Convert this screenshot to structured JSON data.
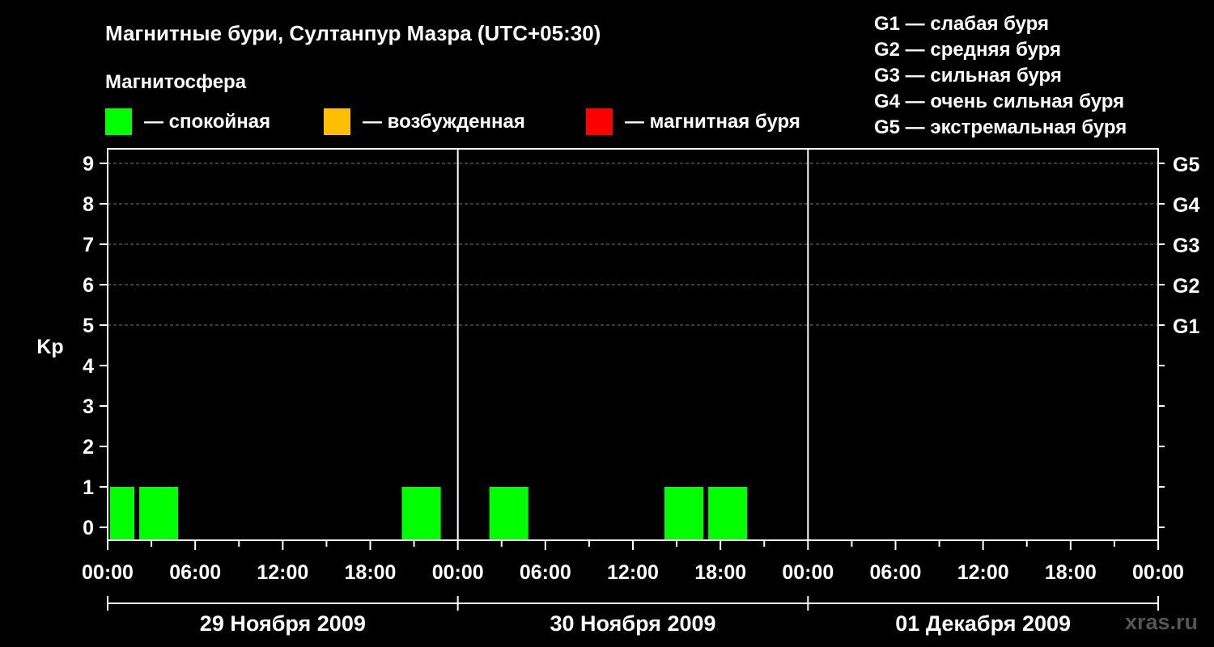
{
  "title": "Магнитные бури, Султанпур Мазра (UTC+05:30)",
  "magnetosphere_label": "Магнитосфера",
  "legend": [
    {
      "color": "#00ff00",
      "label": "— спокойная"
    },
    {
      "color": "#ffbf00",
      "label": "— возбужденная"
    },
    {
      "color": "#ff0000",
      "label": "— магнитная буря"
    }
  ],
  "storm_scale": [
    "G1 — слабая буря",
    "G2 — средняя буря",
    "G3 — сильная буря",
    "G4 — очень сильная буря",
    "G5 — экстремальная буря"
  ],
  "watermark": "xras.ru",
  "chart_data": {
    "type": "bar",
    "ylabel": "Kp",
    "ylim": [
      0,
      9
    ],
    "yticks": [
      "0",
      "1",
      "2",
      "3",
      "4",
      "5",
      "6",
      "7",
      "8",
      "9"
    ],
    "g_levels": [
      {
        "label": "G1",
        "kp": 5
      },
      {
        "label": "G2",
        "kp": 6
      },
      {
        "label": "G3",
        "kp": 7
      },
      {
        "label": "G4",
        "kp": 8
      },
      {
        "label": "G5",
        "kp": 9
      }
    ],
    "xlim_hours": [
      0,
      72
    ],
    "xtick_labels": [
      "00:00",
      "06:00",
      "12:00",
      "18:00",
      "00:00",
      "06:00",
      "12:00",
      "18:00",
      "00:00",
      "06:00",
      "12:00",
      "18:00",
      "00:00"
    ],
    "dates": [
      "29 Ноября 2009",
      "30 Ноября 2009",
      "01 Декабря 2009"
    ],
    "bars": [
      {
        "start": "29.11.2009 00:00",
        "end": "29.11.2009 02:00",
        "kp": 1,
        "level": "спокойная",
        "color": "#00ff00"
      },
      {
        "start": "29.11.2009 02:00",
        "end": "29.11.2009 05:00",
        "kp": 1,
        "level": "спокойная",
        "color": "#00ff00"
      },
      {
        "start": "29.11.2009 20:00",
        "end": "29.11.2009 23:00",
        "kp": 1,
        "level": "спокойная",
        "color": "#00ff00"
      },
      {
        "start": "30.11.2009 02:00",
        "end": "30.11.2009 05:00",
        "kp": 1,
        "level": "спокойная",
        "color": "#00ff00"
      },
      {
        "start": "30.11.2009 14:00",
        "end": "30.11.2009 17:00",
        "kp": 1,
        "level": "спокойная",
        "color": "#00ff00"
      },
      {
        "start": "30.11.2009 17:00",
        "end": "30.11.2009 20:00",
        "kp": 1,
        "level": "спокойная",
        "color": "#00ff00"
      }
    ],
    "grid": "dashed horizontal at Kp 5–9",
    "legend_placement": "top"
  }
}
